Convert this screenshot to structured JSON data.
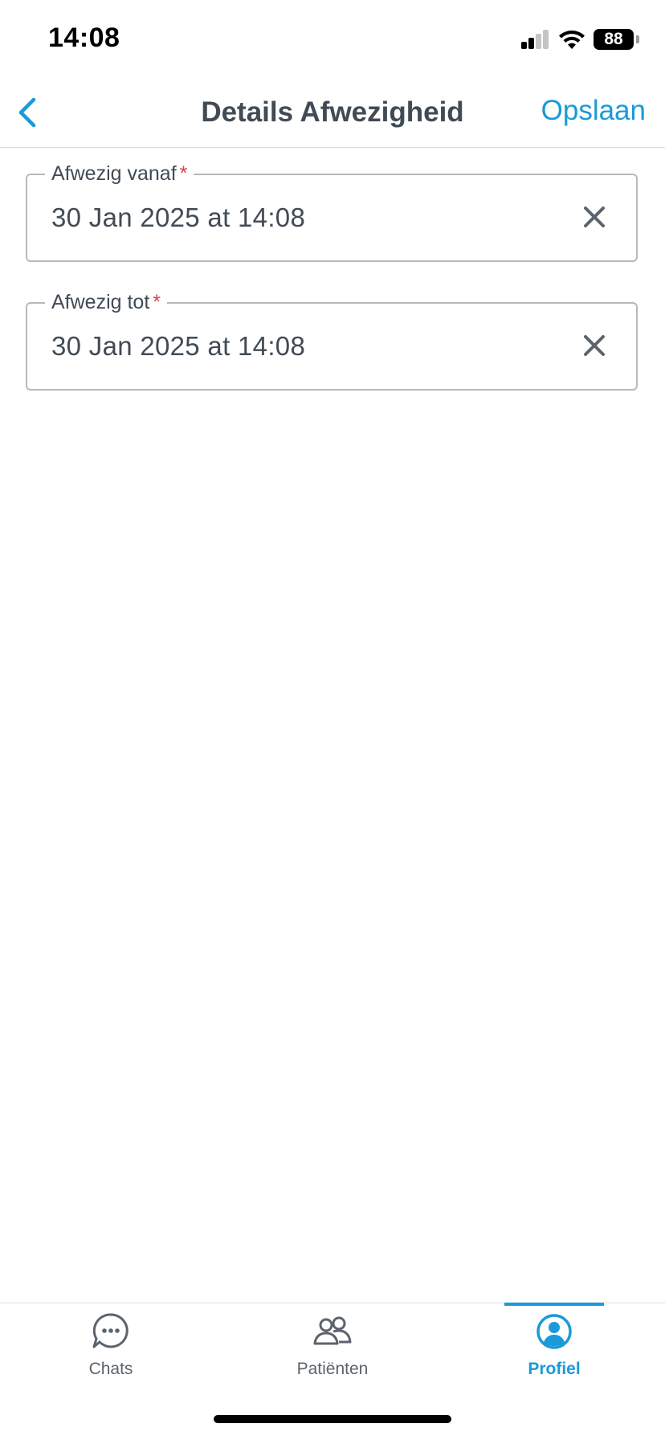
{
  "status_bar": {
    "time": "14:08",
    "battery": "88",
    "icons": [
      "signal-icon",
      "wifi-icon",
      "battery-icon"
    ]
  },
  "header": {
    "title": "Details Afwezigheid",
    "save_label": "Opslaan",
    "back_icon": "chevron-left-icon"
  },
  "form": {
    "from": {
      "label": "Afwezig vanaf",
      "required": "*",
      "value": "30 Jan 2025 at 14:08",
      "clear_icon": "close-icon"
    },
    "to": {
      "label": "Afwezig tot",
      "required": "*",
      "value": "30 Jan 2025 at 14:08",
      "clear_icon": "close-icon"
    }
  },
  "tab_bar": {
    "active": "Profiel",
    "tabs": [
      {
        "label": "Chats",
        "icon": "chat-bubble-icon"
      },
      {
        "label": "Patiënten",
        "icon": "people-icon"
      },
      {
        "label": "Profiel",
        "icon": "profile-icon"
      }
    ]
  },
  "colors": {
    "accent": "#1a9ad8",
    "text": "#414b55",
    "required": "#d9404a",
    "border": "#b6babe"
  }
}
